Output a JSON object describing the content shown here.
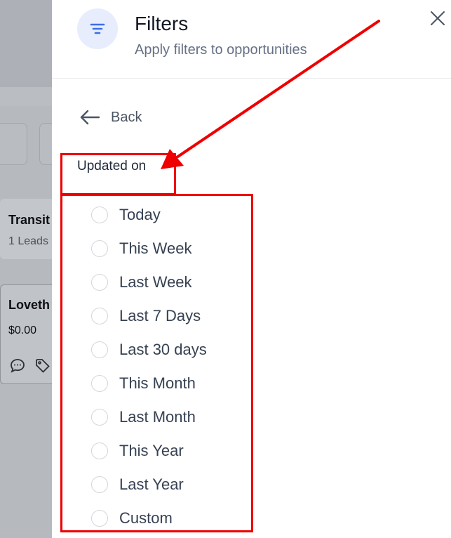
{
  "background": {
    "column": {
      "title": "Transit",
      "subtitle": "1 Leads"
    },
    "lead": {
      "name": "Loveth",
      "value": "$0.00",
      "icons": [
        "chat-bubble-icon",
        "tag-icon"
      ]
    }
  },
  "panel": {
    "icon": "filter-icon",
    "title": "Filters",
    "subtitle": "Apply filters to opportunities",
    "close_icon": "close-icon",
    "back": {
      "icon": "arrow-left-icon",
      "label": "Back"
    },
    "section_label": "Updated on",
    "options": [
      {
        "label": "Today",
        "selected": false
      },
      {
        "label": "This Week",
        "selected": false
      },
      {
        "label": "Last Week",
        "selected": false
      },
      {
        "label": "Last 7 Days",
        "selected": false
      },
      {
        "label": "Last 30 days",
        "selected": false
      },
      {
        "label": "This Month",
        "selected": false
      },
      {
        "label": "Last Month",
        "selected": false
      },
      {
        "label": "This Year",
        "selected": false
      },
      {
        "label": "Last Year",
        "selected": false
      },
      {
        "label": "Custom",
        "selected": false
      }
    ]
  },
  "colors": {
    "annotation": "#ef0000",
    "accent": "#3b6ee8",
    "text_primary": "#131722",
    "text_secondary": "#667085"
  }
}
